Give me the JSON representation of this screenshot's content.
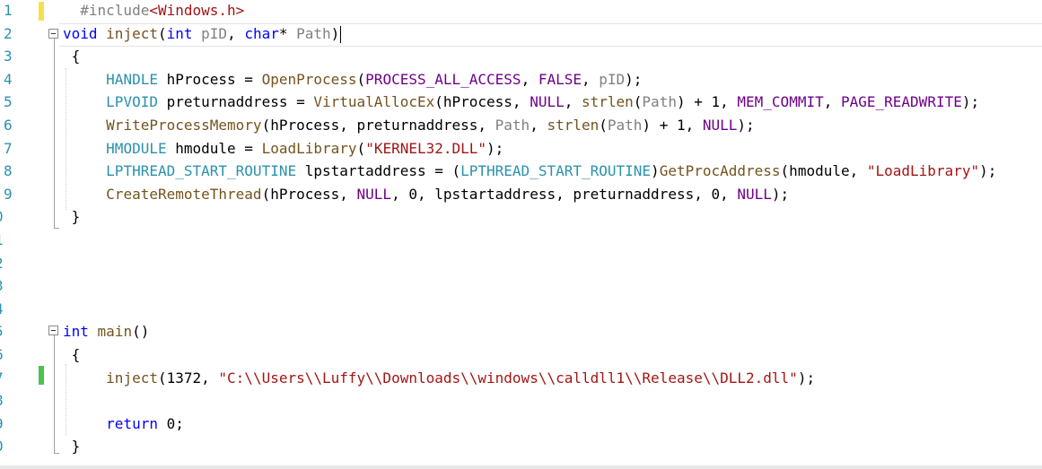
{
  "line_numbers": [
    "1",
    "2",
    "3",
    "4",
    "5",
    "6",
    "7",
    "8",
    "9",
    "0",
    "1",
    "2",
    "3",
    "4",
    "5",
    "6",
    "7",
    "8",
    "9",
    "0"
  ],
  "change_colors": {
    "modified": "#f6e04a",
    "saved": "#4ec24e"
  },
  "code": {
    "l1": {
      "hash": "#include",
      "open": "<",
      "header": "Windows.h",
      "close": ">"
    },
    "l2": {
      "kw_void": "void",
      "name": "inject",
      "p1": "(",
      "kw_int": "int",
      "arg1": "pID",
      "comma": ", ",
      "kw_char": "char",
      "star": "* ",
      "arg2": "Path",
      "p2": ")"
    },
    "l3": {
      "text": "{"
    },
    "l4": {
      "t1": "HANDLE",
      "t2": " hProcess = ",
      "f1": "OpenProcess",
      "t3": "(",
      "m1": "PROCESS_ALL_ACCESS",
      "t4": ", ",
      "m2": "FALSE",
      "t5": ", ",
      "a1": "pID",
      "t6": ");"
    },
    "l5": {
      "t1": "LPVOID",
      "t2": " preturnaddress = ",
      "f1": "VirtualAllocEx",
      "t3": "(hProcess, ",
      "m1": "NULL",
      "t4": ", ",
      "f2": "strlen",
      "t5": "(",
      "a1": "Path",
      "t6": ") + 1, ",
      "m2": "MEM_COMMIT",
      "t7": ", ",
      "m3": "PAGE_READWRITE",
      "t8": ");"
    },
    "l6": {
      "f1": "WriteProcessMemory",
      "t1": "(hProcess, preturnaddress, ",
      "a1": "Path",
      "t2": ", ",
      "f2": "strlen",
      "t3": "(",
      "a2": "Path",
      "t4": ") + 1, ",
      "m1": "NULL",
      "t5": ");"
    },
    "l7": {
      "t1": "HMODULE",
      "t2": " hmodule = ",
      "f1": "LoadLibrary",
      "t3": "(",
      "s1": "\"KERNEL32.DLL\"",
      "t4": ");"
    },
    "l8": {
      "t1": "LPTHREAD_START_ROUTINE",
      "t2": " lpstartaddress = (",
      "t3": "LPTHREAD_START_ROUTINE",
      "t4": ")",
      "f1": "GetProcAddress",
      "t5": "(hmodule, ",
      "s1": "\"LoadLibrary\"",
      "t6": ");"
    },
    "l9": {
      "f1": "CreateRemoteThread",
      "t1": "(hProcess, ",
      "m1": "NULL",
      "t2": ", 0, lpstartaddress, preturnaddress, 0, ",
      "m2": "NULL",
      "t3": ");"
    },
    "l10": {
      "text": "}"
    },
    "l15": {
      "kw_int": "int",
      "name": " main",
      "rest": "()"
    },
    "l16": {
      "text": "{"
    },
    "l17": {
      "f1": "inject",
      "t1": "(1372, ",
      "s1": "\"C:\\\\Users\\\\Luffy\\\\Downloads\\\\windows\\\\calldll1\\\\Release\\\\DLL2.dll\"",
      "t2": ");"
    },
    "l19": {
      "kw": "return",
      "t1": " 0;"
    },
    "l20": {
      "text": "}"
    }
  }
}
